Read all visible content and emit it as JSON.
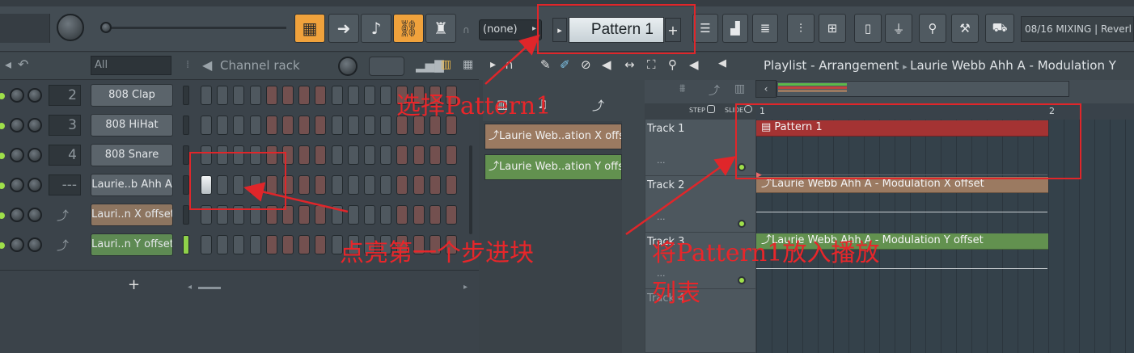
{
  "toolbar": {
    "pattern_dropdown": "(none)",
    "pattern_prev": "▸",
    "pattern_name": "Pattern 1",
    "pattern_add": "+",
    "mixing_info": "08/16  MIXING | Reverl"
  },
  "channel_rack": {
    "filter": "All",
    "title": "Channel rack",
    "add_label": "+",
    "channels": [
      {
        "num": "2",
        "name": "808 Clap",
        "style": "grey"
      },
      {
        "num": "3",
        "name": "808 HiHat",
        "style": "grey"
      },
      {
        "num": "4",
        "name": "808 Snare",
        "style": "grey"
      },
      {
        "num": "---",
        "name": "Laurie..b Ahh A",
        "style": "grey"
      },
      {
        "num": "",
        "name": "Lauri..n X offset",
        "style": "brown"
      },
      {
        "num": "",
        "name": "Lauri..n Y offset",
        "style": "green"
      }
    ]
  },
  "playlist": {
    "title": "Playlist - Arrangement",
    "breadcrumb": "Laurie Webb Ahh A - Modulation Y",
    "step_label": "STEP",
    "slide_label": "SLIDE",
    "ruler": [
      "1",
      "2"
    ],
    "picker": [
      {
        "name": "Laurie Web..ation X offset",
        "style": "brown"
      },
      {
        "name": "Laurie Web..ation Y offset",
        "style": "green"
      }
    ],
    "tracks": [
      "Track 1",
      "Track 2",
      "Track 3",
      "Track 4"
    ],
    "track_dots": "...",
    "clips": [
      {
        "name": "Pattern 1",
        "style": "red"
      },
      {
        "name": "Laurie Webb Ahh A - Modulation X offset",
        "style": "brown"
      },
      {
        "name": "Laurie Webb Ahh A - Modulation Y offset",
        "style": "green"
      }
    ]
  },
  "annotations": {
    "select_pattern": "选择Pattern1",
    "click_step": "点亮第一个步进块",
    "place_pattern_line1": "将Pattern1放入播放",
    "place_pattern_line2": "列表"
  },
  "colors": {
    "accent_orange": "#f0a23c",
    "annotation_red": "#e0262a",
    "led_green": "#9fe04a"
  }
}
